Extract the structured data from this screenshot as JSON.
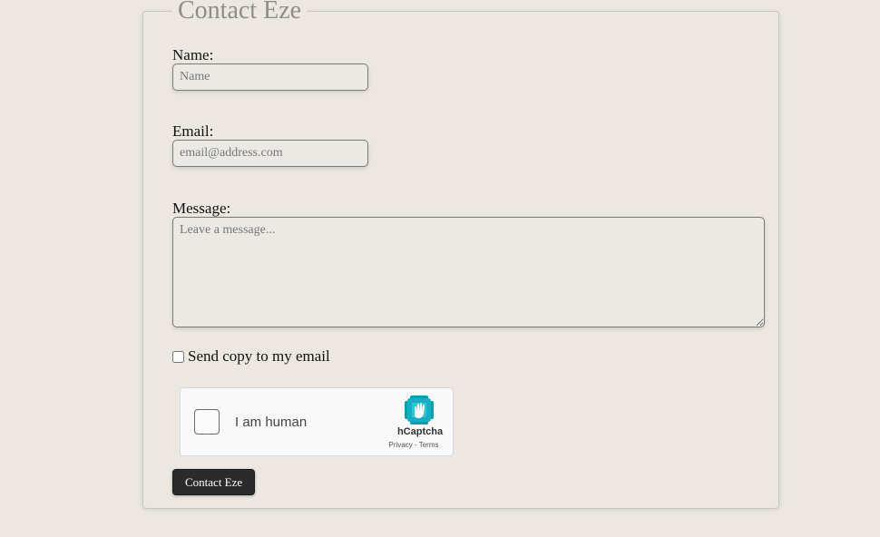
{
  "form": {
    "legend": "Contact Eze",
    "name_label": "Name:",
    "name_placeholder": "Name",
    "email_label": "Email:",
    "email_placeholder": "email@address.com",
    "message_label": "Message:",
    "message_placeholder": "Leave a message...",
    "copy_checkbox_label": "Send copy to my email",
    "copy_checked": false,
    "submit_label": "Contact Eze"
  },
  "captcha": {
    "label": "I am human",
    "brand": "hCaptcha",
    "privacy_link": "Privacy",
    "separator": " - ",
    "terms_link": "Terms",
    "logo_icon": "hcaptcha-hand-icon",
    "accent": "#0074bf"
  },
  "colors": {
    "background": "#ece8e1",
    "legend_text": "#8e8d88",
    "button_bg": "#2b2b2b"
  }
}
